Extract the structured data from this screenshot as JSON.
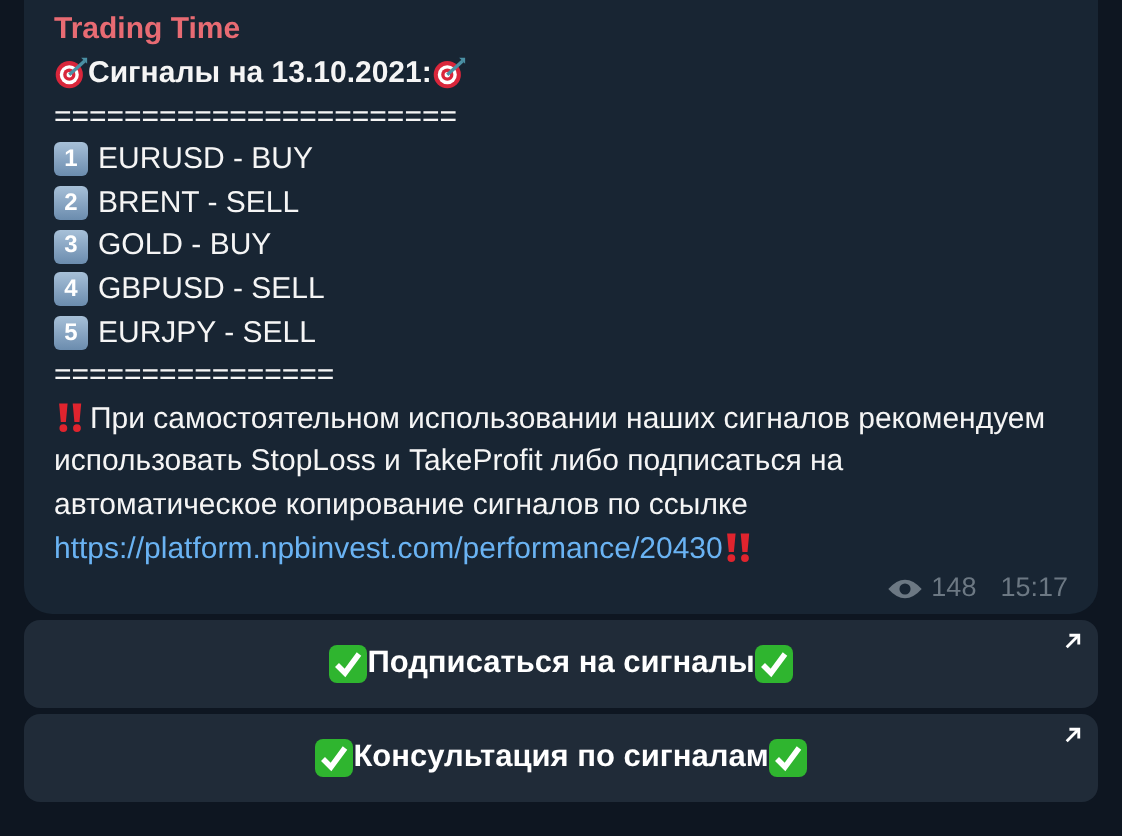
{
  "message": {
    "sender": "Trading Time",
    "heading": "Сигналы на 13.10.2021:",
    "separator_top": "=======================",
    "signals": [
      {
        "number": "1",
        "text": "EURUSD - BUY"
      },
      {
        "number": "2",
        "text": "BRENT - SELL"
      },
      {
        "number": "3",
        "text": "GOLD - BUY"
      },
      {
        "number": "4",
        "text": "GBPUSD - SELL"
      },
      {
        "number": "5",
        "text": "EURJPY - SELL"
      }
    ],
    "separator_bottom": "================",
    "warning": {
      "text": "При самостоятельном использовании наших сигналов рекомендуем использовать StopLoss и TakeProfit либо подписаться на автоматическое копирование сигналов по ссылке ",
      "link": "https://platform.npbinvest.com/performance/20430"
    },
    "views": "148",
    "time": "15:17"
  },
  "buttons": [
    {
      "label": "Подписаться на сигналы"
    },
    {
      "label": "Консультация по сигналам"
    }
  ]
}
